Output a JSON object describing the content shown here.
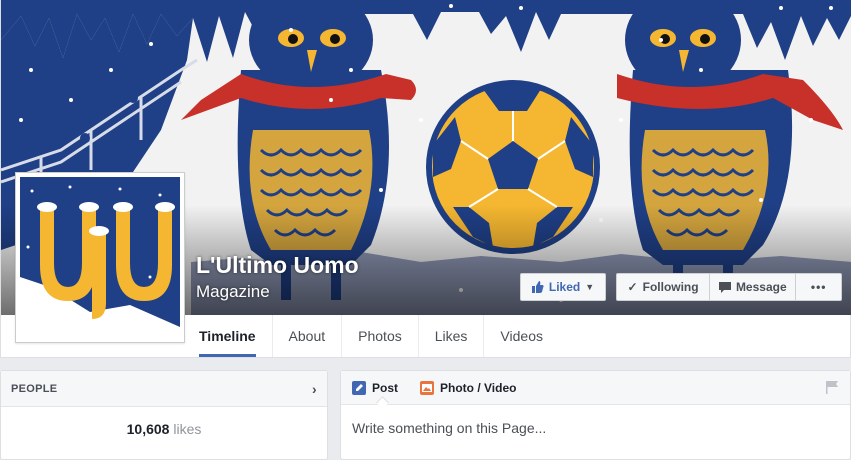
{
  "page": {
    "name": "L'Ultimo Uomo",
    "category": "Magazine"
  },
  "actions": {
    "liked": "Liked",
    "following": "Following",
    "message": "Message",
    "more": "•••"
  },
  "tabs": [
    "Timeline",
    "About",
    "Photos",
    "Likes",
    "Videos"
  ],
  "people": {
    "heading": "PEOPLE",
    "likes_count": "10,608",
    "likes_label": "likes"
  },
  "composer": {
    "post_label": "Post",
    "photo_label": "Photo / Video",
    "placeholder": "Write something on this Page..."
  },
  "colors": {
    "navy": "#1f3f86",
    "gold": "#f5b731",
    "scarf": "#c8302a",
    "fb_blue": "#4267b2"
  },
  "icons": {
    "liked": "thumbs-up-icon",
    "following": "checkmark-icon",
    "message": "speech-bubble-icon",
    "people_arrow": "chevron-right-icon",
    "post": "pencil-icon",
    "photo": "photo-icon",
    "flag": "flag-icon"
  }
}
